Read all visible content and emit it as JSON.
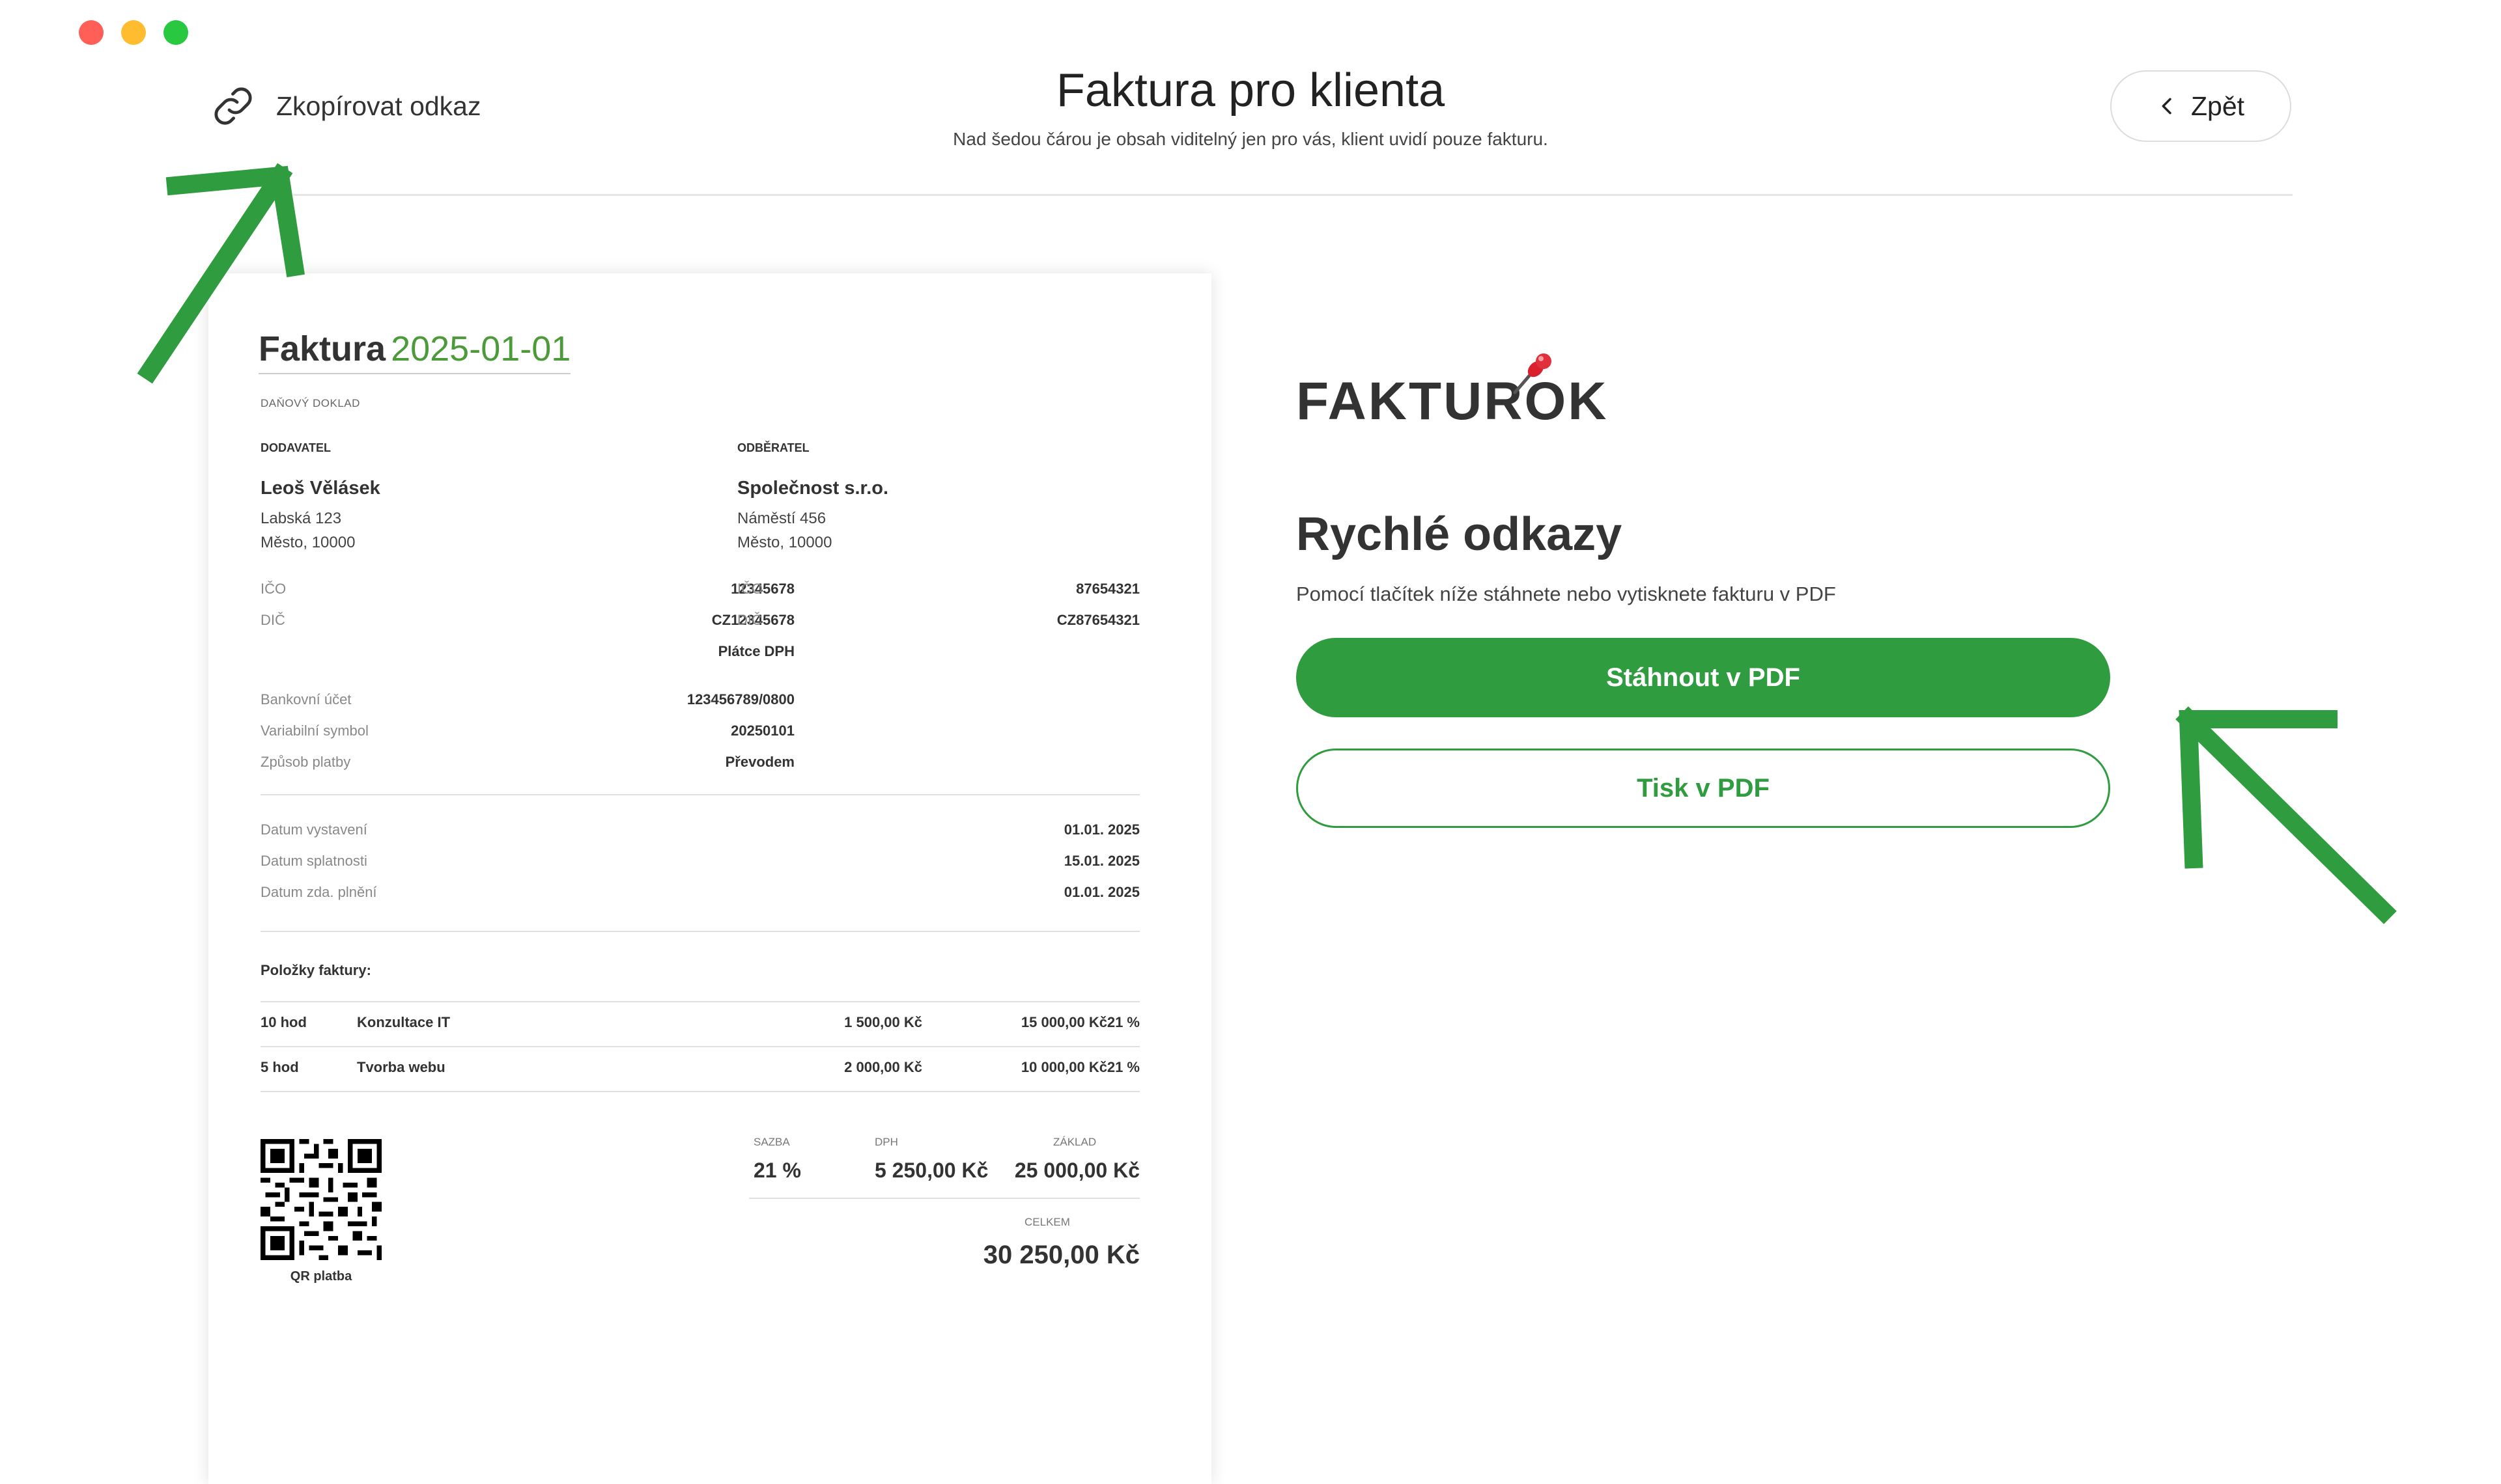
{
  "window": {
    "traffic_colors": [
      "#ff5f57",
      "#febc2e",
      "#28c840"
    ]
  },
  "header": {
    "copy_link_label": "Zkopírovat odkaz",
    "title": "Faktura pro klienta",
    "subtitle": "Nad šedou čárou je obsah viditelný jen pro vás, klient uvidí pouze fakturu.",
    "back_label": "Zpět"
  },
  "invoice": {
    "title_word": "Faktura",
    "number": "2025-01-01",
    "doc_type": "DAŇOVÝ DOKLAD",
    "supplier": {
      "heading": "DODAVATEL",
      "name": "Leoš Vělásek",
      "street": "Labská 123",
      "city": "Město, 10000",
      "ico_label": "IČO",
      "ico": "12345678",
      "dic_label": "DIČ",
      "dic": "CZ12345678",
      "vat_note": "Plátce DPH",
      "bank_label": "Bankovní účet",
      "bank": "123456789/0800",
      "vs_label": "Variabilní symbol",
      "vs": "20250101",
      "payment_label": "Způsob platby",
      "payment": "Převodem"
    },
    "customer": {
      "heading": "ODBĚRATEL",
      "name": "Společnost s.r.o.",
      "street": "Náměstí 456",
      "city": "Město, 10000",
      "ico_label": "IČO",
      "ico": "87654321",
      "dic_label": "DIČ",
      "dic": "CZ87654321"
    },
    "dates": [
      {
        "label": "Datum vystavení",
        "value": "01.01. 2025"
      },
      {
        "label": "Datum splatnosti",
        "value": "15.01. 2025"
      },
      {
        "label": "Datum zda. plnění",
        "value": "01.01. 2025"
      }
    ],
    "items_title": "Položky faktury:",
    "items": [
      {
        "qty": "10 hod",
        "name": "Konzultace IT",
        "unit": "1 500,00 Kč",
        "total": "15 000,00 Kč",
        "vat": "21 %"
      },
      {
        "qty": "5 hod",
        "name": "Tvorba webu",
        "unit": "2 000,00 Kč",
        "total": "10 000,00 Kč",
        "vat": "21 %"
      }
    ],
    "qr_label": "QR platba",
    "summary": {
      "rate_label": "SAZBA",
      "rate": "21 %",
      "vat_label": "DPH",
      "vat": "5 250,00 Kč",
      "base_label": "ZÁKLAD",
      "base": "25 000,00 Kč",
      "total_label": "CELKEM",
      "total": "30 250,00 Kč"
    }
  },
  "panel": {
    "logo": "FAKTUROK",
    "quick_title": "Rychlé odkazy",
    "quick_desc": "Pomocí tlačítek níže stáhnete nebo vytisknete fakturu v PDF",
    "download_label": "Stáhnout v PDF",
    "print_label": "Tisk v PDF"
  },
  "colors": {
    "accent": "#2e9c3f",
    "invoice_number": "#4d9a3b"
  }
}
